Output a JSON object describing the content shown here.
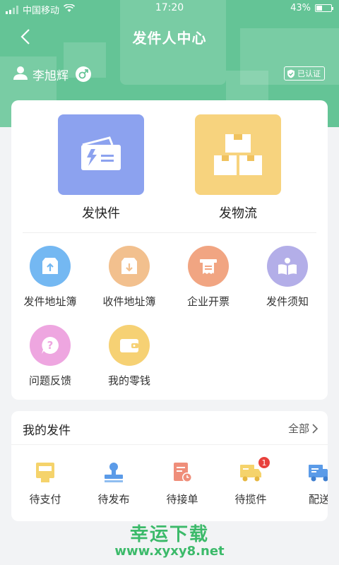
{
  "status_bar": {
    "carrier": "中国移动",
    "time": "17:20",
    "battery": "43%"
  },
  "header": {
    "title": "发件人中心",
    "user_name": "李旭辉",
    "verified": "已认证"
  },
  "main": {
    "big_items": [
      {
        "label": "发快件",
        "icon": "express-card-icon",
        "color": "#8ca2ef"
      },
      {
        "label": "发物流",
        "icon": "boxes-icon",
        "color": "#f7d37e"
      }
    ],
    "grid_items": [
      {
        "label": "发件地址簿",
        "icon": "send-address-icon",
        "color": "#74b8f2"
      },
      {
        "label": "收件地址簿",
        "icon": "receive-address-icon",
        "color": "#f2c08e"
      },
      {
        "label": "企业开票",
        "icon": "invoice-icon",
        "color": "#f1a582"
      },
      {
        "label": "发件须知",
        "icon": "book-icon",
        "color": "#b3aee8"
      },
      {
        "label": "问题反馈",
        "icon": "question-icon",
        "color": "#eea6e0"
      },
      {
        "label": "我的零钱",
        "icon": "wallet-icon",
        "color": "#f6d174"
      }
    ]
  },
  "my_shipments": {
    "title": "我的发件",
    "view_all": "全部",
    "statuses": [
      {
        "label": "待支付",
        "icon": "pay-icon"
      },
      {
        "label": "待发布",
        "icon": "publish-stamp-icon"
      },
      {
        "label": "待接单",
        "icon": "accept-order-icon"
      },
      {
        "label": "待揽件",
        "icon": "pickup-truck-icon",
        "badge": "1"
      },
      {
        "label": "配送",
        "icon": "delivery-truck-icon"
      }
    ]
  },
  "watermark": {
    "line1": "幸运下载",
    "line2": "www.xyxy8.net"
  },
  "colors": {
    "header_green": "#64c496",
    "badge_red": "#e8413c",
    "watermark_green": "#3cba6a"
  }
}
